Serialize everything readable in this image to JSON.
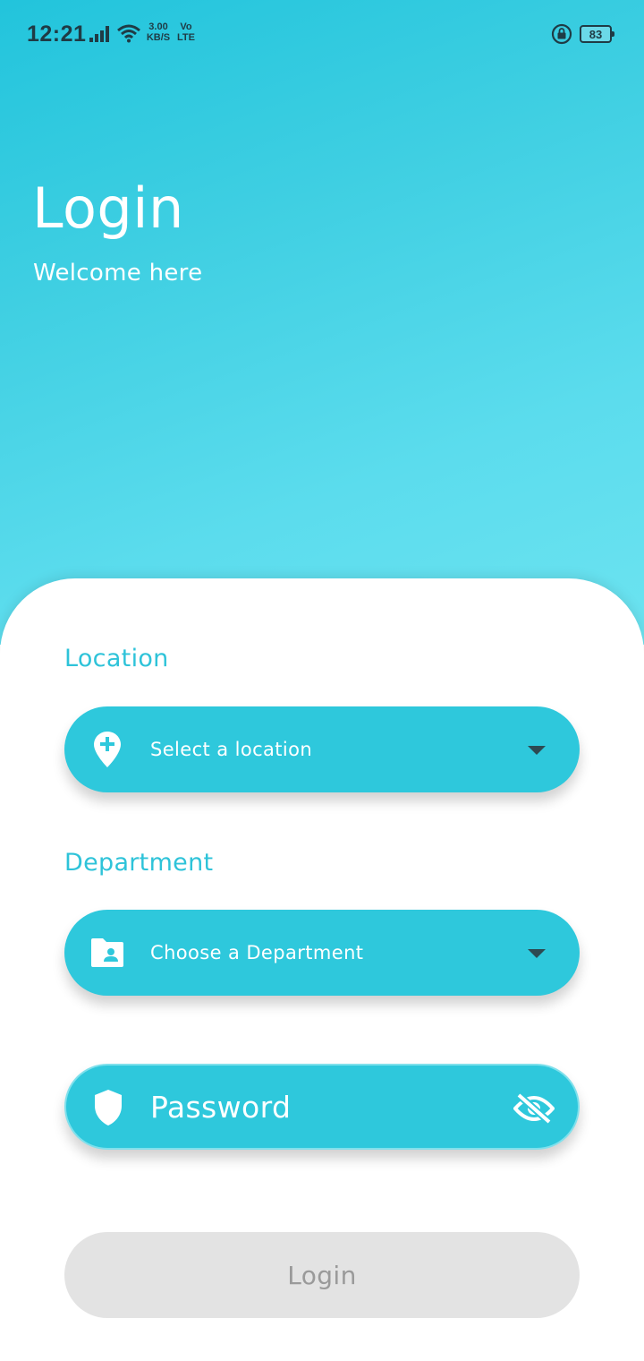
{
  "status_bar": {
    "time": "12:21",
    "net_speed_value": "3.00",
    "net_speed_unit": "KB/S",
    "volte_top": "Vo",
    "volte_bottom": "LTE",
    "battery": "83"
  },
  "header": {
    "title": "Login",
    "subtitle": "Welcome here"
  },
  "form": {
    "location": {
      "label": "Location",
      "placeholder": "Select a location",
      "icon": "location-pin-plus-icon"
    },
    "department": {
      "label": "Department",
      "placeholder": "Choose a Department",
      "icon": "folder-user-icon"
    },
    "password": {
      "placeholder": "Password",
      "icon": "shield-icon",
      "toggle_icon": "eye-off-icon"
    },
    "submit_label": "Login"
  },
  "colors": {
    "accent": "#2ec8dc",
    "label": "#2ec3d9",
    "button_disabled_bg": "#e3e3e3",
    "button_disabled_text": "#9a9a9a"
  }
}
